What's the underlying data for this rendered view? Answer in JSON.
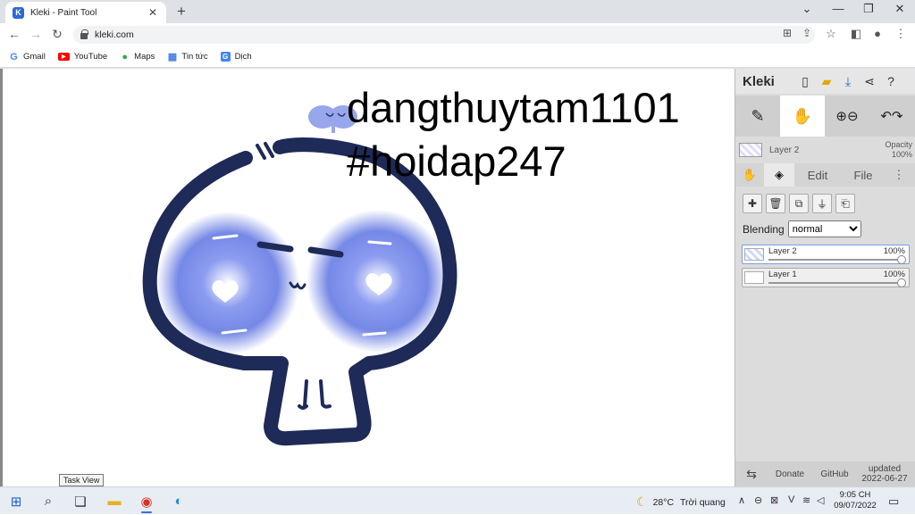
{
  "browser": {
    "tab_title": "Kleki - Paint Tool",
    "tab_favicon": "K",
    "url": "kleki.com",
    "bookmarks": [
      {
        "label": "Gmail",
        "icon": "G",
        "color": "#4285f4"
      },
      {
        "label": "YouTube",
        "icon": "▶",
        "color": "#ff0000"
      },
      {
        "label": "Maps",
        "icon": "●",
        "color": "#34a853"
      },
      {
        "label": "Tin tức",
        "icon": "▦",
        "color": "#4a7fe0"
      },
      {
        "label": "Dịch",
        "icon": "G",
        "color": "#4285f4"
      }
    ]
  },
  "canvas": {
    "line1": "dangthuytam1101",
    "line2": "#hoidap247"
  },
  "kleki": {
    "logo": "Kleki",
    "layer_name": "Layer 2",
    "opacity_label": "Opacity",
    "opacity_value": "100%",
    "tabs": {
      "edit": "Edit",
      "file": "File"
    },
    "blending_label": "Blending",
    "blending_value": "normal",
    "layers": [
      {
        "name": "Layer 2",
        "opacity": "100%",
        "selected": true
      },
      {
        "name": "Layer 1",
        "opacity": "100%",
        "selected": false
      }
    ],
    "footer": {
      "donate": "Donate",
      "github": "GitHub",
      "updated_label": "updated",
      "updated_date": "2022-06-27"
    }
  },
  "taskbar": {
    "tooltip": "Task View",
    "temperature": "28°C",
    "weather": "Trời quang",
    "time": "9:05 CH",
    "date": "09/07/2022"
  },
  "colors": {
    "skull_outline": "#1e2a57",
    "eye_blue": "#6b7fe0",
    "accent": "#2a6ad8"
  }
}
